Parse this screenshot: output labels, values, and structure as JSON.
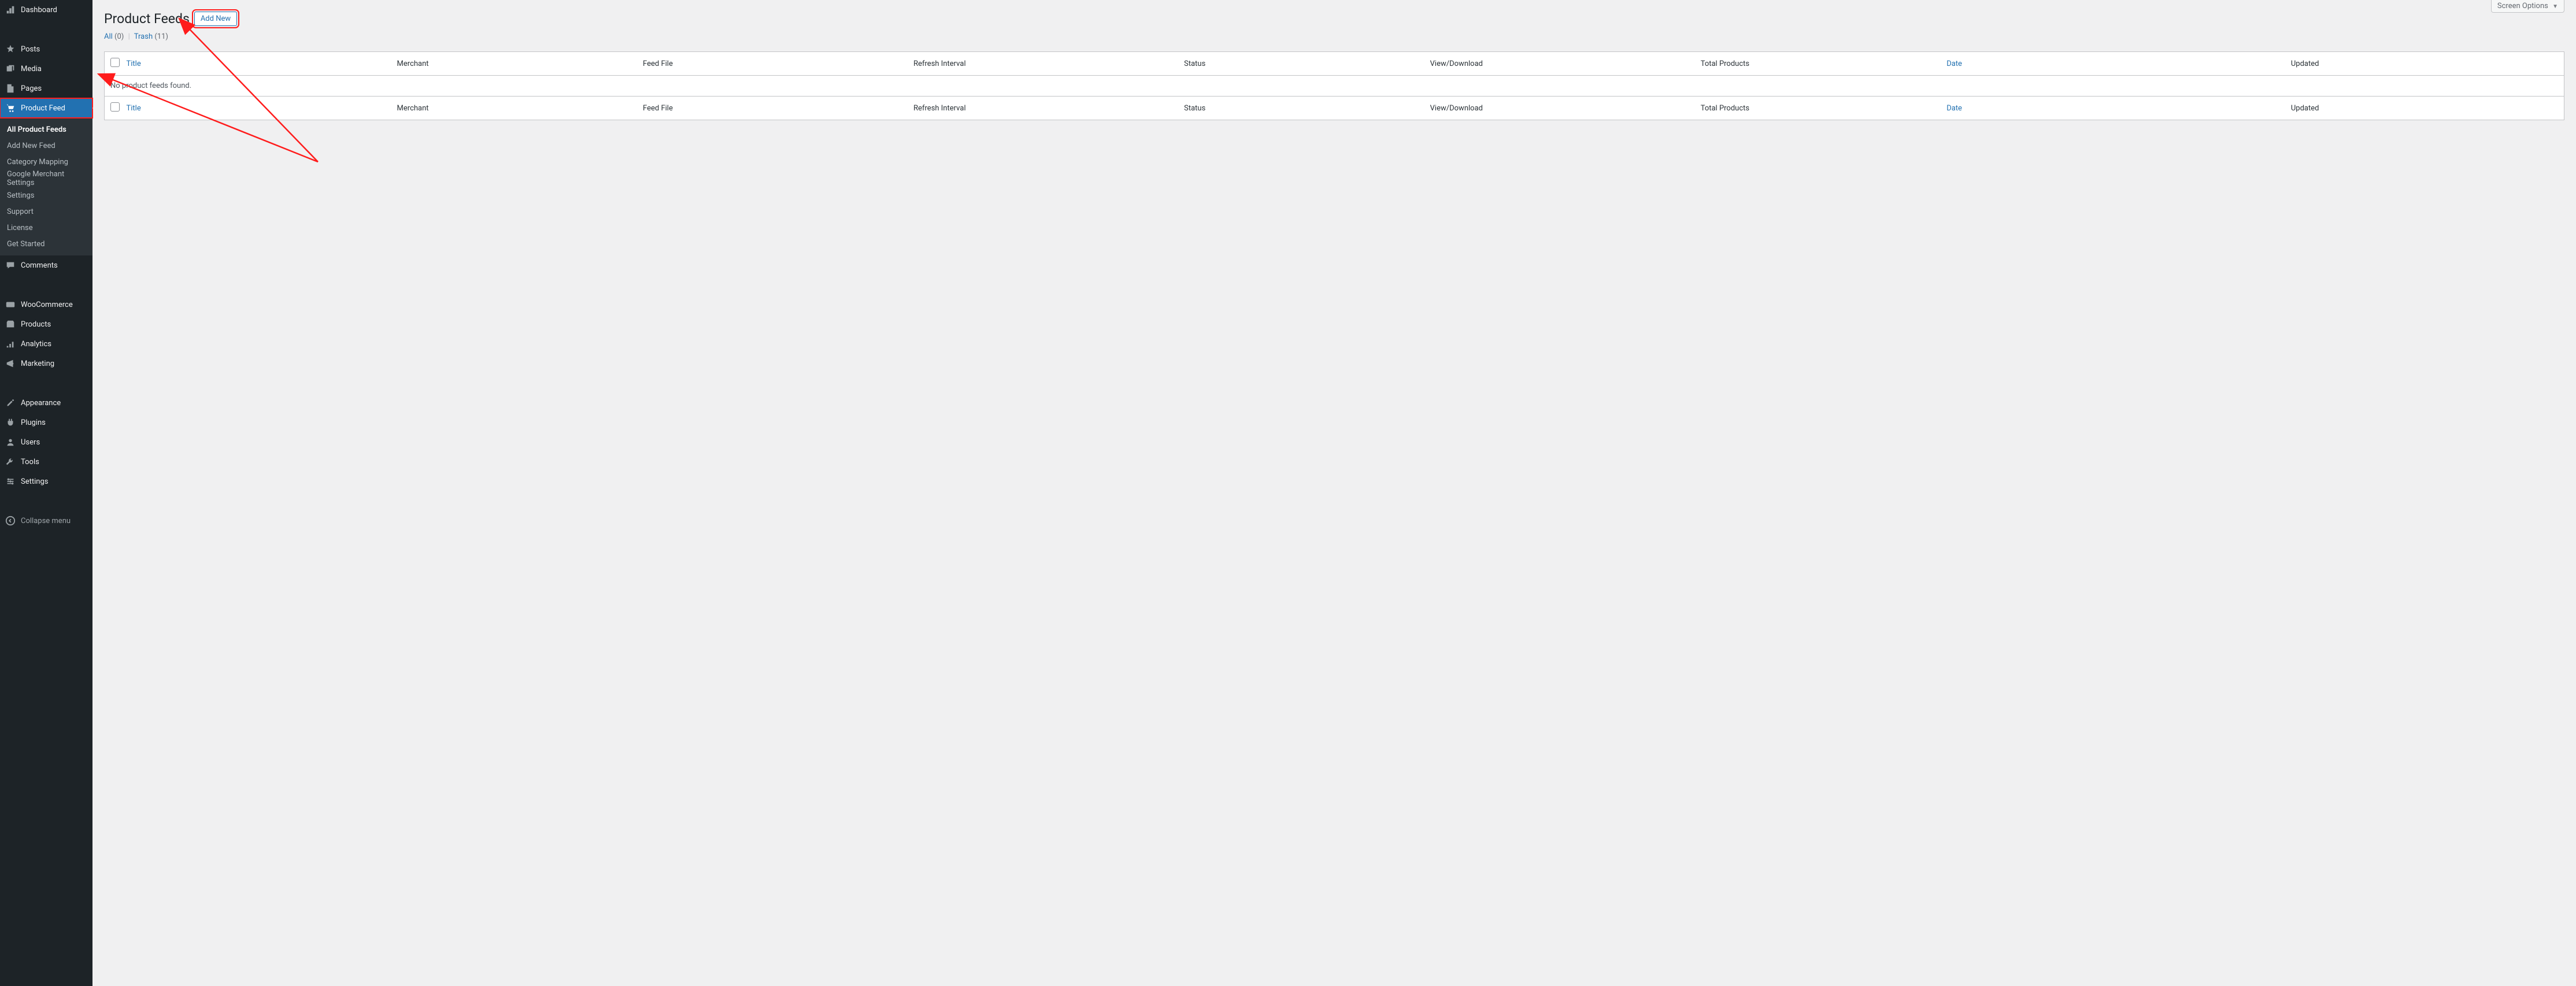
{
  "sidebar": {
    "items": [
      {
        "label": "Dashboard",
        "icon": "dashboard"
      },
      {
        "label": "Posts",
        "icon": "pin"
      },
      {
        "label": "Media",
        "icon": "media"
      },
      {
        "label": "Pages",
        "icon": "pages"
      },
      {
        "label": "Product Feed",
        "icon": "cart",
        "current": true
      }
    ],
    "submenu": [
      {
        "label": "All Product Feeds",
        "current": true
      },
      {
        "label": "Add New Feed"
      },
      {
        "label": "Category Mapping"
      },
      {
        "label": "Google Merchant Settings"
      },
      {
        "label": "Settings"
      },
      {
        "label": "Support"
      },
      {
        "label": "License"
      },
      {
        "label": "Get Started"
      }
    ],
    "items2": [
      {
        "label": "Comments",
        "icon": "comment"
      },
      {
        "label": "WooCommerce",
        "icon": "woo"
      },
      {
        "label": "Products",
        "icon": "product"
      },
      {
        "label": "Analytics",
        "icon": "analytics"
      },
      {
        "label": "Marketing",
        "icon": "marketing"
      },
      {
        "label": "Appearance",
        "icon": "appearance"
      },
      {
        "label": "Plugins",
        "icon": "plugin"
      },
      {
        "label": "Users",
        "icon": "users"
      },
      {
        "label": "Tools",
        "icon": "tools"
      },
      {
        "label": "Settings",
        "icon": "settings"
      }
    ],
    "collapse_label": "Collapse menu"
  },
  "screen_options_label": "Screen Options",
  "page": {
    "title": "Product Feeds",
    "add_new_label": "Add New"
  },
  "filters": {
    "all_label": "All",
    "all_count": "(0)",
    "trash_label": "Trash",
    "trash_count": "(11)"
  },
  "table": {
    "columns": {
      "title": "Title",
      "merchant": "Merchant",
      "feed_file": "Feed File",
      "refresh_interval": "Refresh Interval",
      "status": "Status",
      "view_download": "View/Download",
      "total_products": "Total Products",
      "date": "Date",
      "updated": "Updated"
    },
    "empty_message": "No product feeds found."
  },
  "annotation": {
    "highlight_color": "#ff1c1c"
  }
}
